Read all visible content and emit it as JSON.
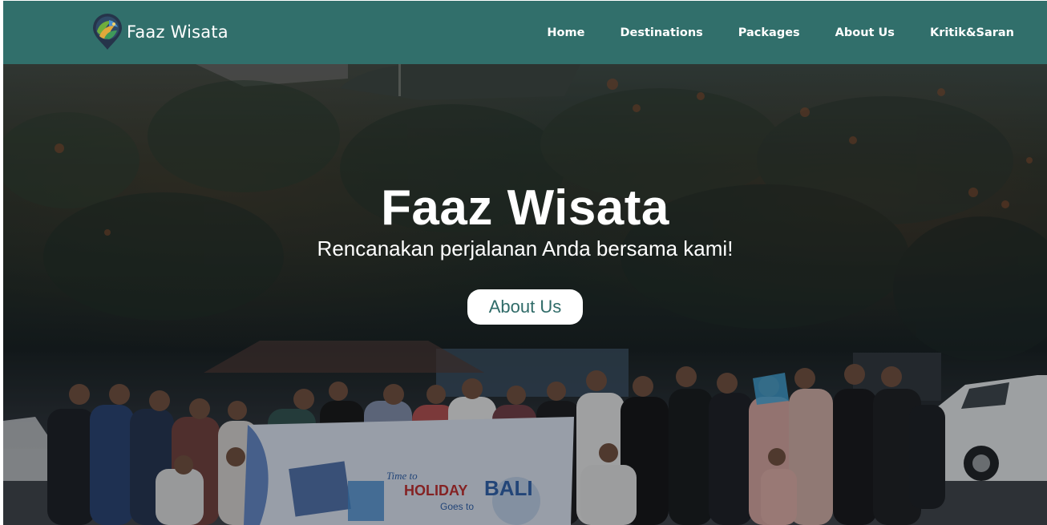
{
  "nav": {
    "brand_name": "Faaz Wisata",
    "logo_icon": "map-pin-logo-icon",
    "links": [
      {
        "label": "Home"
      },
      {
        "label": "Destinations"
      },
      {
        "label": "Packages"
      },
      {
        "label": "About Us"
      },
      {
        "label": "Kritik&Saran"
      }
    ]
  },
  "hero": {
    "title": "Faaz Wisata",
    "subtitle": "Rencanakan perjalanan Anda bersama kami!",
    "button_label": "About Us",
    "banner_text_1": "Time to",
    "banner_text_2": "HOLIDAY",
    "banner_text_3": "BALI",
    "banner_text_4": "Goes to"
  },
  "colors": {
    "navbar": "#316f6b",
    "button_text": "#2f6b68",
    "text": "#ffffff"
  }
}
